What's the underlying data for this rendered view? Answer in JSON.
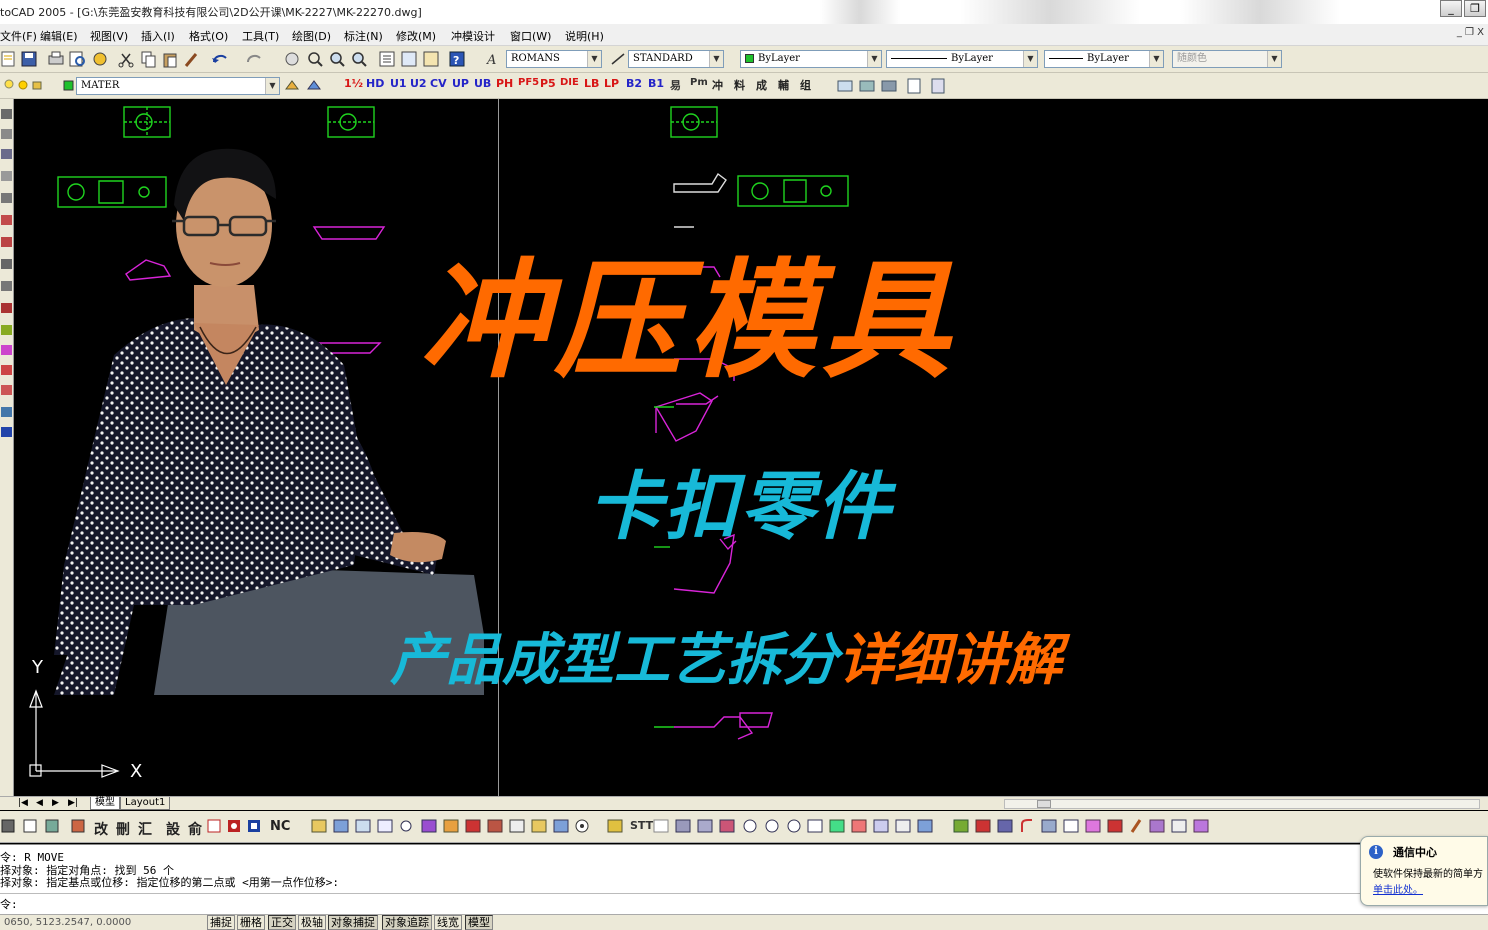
{
  "window": {
    "title": "toCAD 2005 - [G:\\东莞盈安教育科技有限公司\\2D公开课\\MK-2227\\MK-22270.dwg]",
    "minimize": "_",
    "restore": "❐",
    "close": "X"
  },
  "menu": {
    "items": [
      "文件(F)",
      "编辑(E)",
      "视图(V)",
      "插入(I)",
      "格式(O)",
      "工具(T)",
      "绘图(D)",
      "标注(N)",
      "修改(M)",
      "冲模设计",
      "窗口(W)",
      "说明(H)"
    ],
    "doc_controls": "_ ❐ X"
  },
  "toolbar_standard": {
    "text_style": "ROMANS",
    "dim_style": "STANDARD"
  },
  "toolbar_properties": {
    "color": "ByLayer",
    "linetype": "ByLayer",
    "lineweight": "ByLayer",
    "plotstyle": "随颜色",
    "layer": "MATER"
  },
  "toolbar_custom": {
    "buttons": [
      "1½",
      "HD",
      "U1",
      "U2",
      "CV",
      "UP",
      "UB",
      "PH",
      "PF5",
      "P5",
      "DIE",
      "LB",
      "LP",
      "B2",
      "B1",
      "易",
      "Pm",
      "冲",
      "料",
      "成",
      "輔",
      "组"
    ]
  },
  "overlay": {
    "title": "冲压模具",
    "subtitle": "卡扣零件",
    "tagline_part1": "产品成型工艺拆分",
    "tagline_part2": "详细讲解"
  },
  "ucs": {
    "x_label": "X",
    "y_label": "Y"
  },
  "tabs": {
    "model": "模型",
    "layout1": "Layout1"
  },
  "toolbar_bottom": {
    "text_buttons": [
      "改",
      "刪",
      "汇",
      "設",
      "俞",
      "NC",
      "STT"
    ]
  },
  "command": {
    "line1": "令: R MOVE",
    "line2": "择对象: 指定对角点: 找到 56 个",
    "line3": "择对象:  指定基点或位移: 指定位移的第二点或 <用第一点作位移>:",
    "prompt": "令:"
  },
  "notification": {
    "title": "通信中心",
    "body": "使软件保持最新的简单方",
    "link": "单击此处。"
  },
  "statusbar": {
    "coords": "0650,  5123.2547,  0.0000",
    "buttons": [
      {
        "label": "捕捉",
        "on": false
      },
      {
        "label": "栅格",
        "on": false
      },
      {
        "label": "正交",
        "on": true
      },
      {
        "label": "极轴",
        "on": false
      },
      {
        "label": "对象捕捉",
        "on": true
      },
      {
        "label": "对象追踪",
        "on": true
      },
      {
        "label": "线宽",
        "on": false
      },
      {
        "label": "模型",
        "on": true
      }
    ]
  },
  "colors": {
    "orange": "#ff6a00",
    "cyan": "#17b9d8",
    "cad_green": "#1fd41f",
    "cad_magenta": "#d824d8"
  }
}
